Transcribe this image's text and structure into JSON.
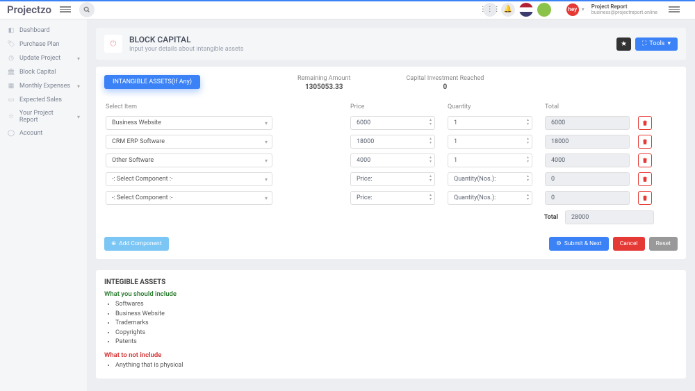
{
  "brand": "Projectzo",
  "user": {
    "title": "Project Report",
    "sub": "business@projectreport.online",
    "avatar_text": "hey"
  },
  "sidebar": {
    "items": [
      {
        "label": "Dashboard",
        "icon": "dashboard"
      },
      {
        "label": "Purchase Plan",
        "icon": "tag"
      },
      {
        "label": "Update Project",
        "icon": "clock",
        "chev": true
      },
      {
        "label": "Block Capital",
        "icon": "bank"
      },
      {
        "label": "Monthly Expenses",
        "icon": "cal",
        "chev": true
      },
      {
        "label": "Expected Sales",
        "icon": "sales"
      },
      {
        "label": "Your Project Report",
        "icon": "star",
        "chev": true
      },
      {
        "label": "Account",
        "icon": "user"
      }
    ]
  },
  "page": {
    "title": "BLOCK CAPITAL",
    "subtitle": "Input your details about intangible assets",
    "tools_label": "Tools"
  },
  "tab": {
    "label": "INTANGIBLE ASSETS(If Any)"
  },
  "metrics": {
    "remaining_label": "Remaining Amount",
    "remaining_value": "1305053.33",
    "reached_label": "Capital Investment Reached",
    "reached_value": "0"
  },
  "columns": {
    "item": "Select Item",
    "price": "Price",
    "qty": "Quantity",
    "total": "Total"
  },
  "rows": [
    {
      "item": "Business Website",
      "price": "6000",
      "qty": "1",
      "total": "6000"
    },
    {
      "item": "CRM ERP Software",
      "price": "18000",
      "qty": "1",
      "total": "18000"
    },
    {
      "item": "Other Software",
      "price": "4000",
      "qty": "1",
      "total": "4000"
    },
    {
      "item": "-: Select Component :-",
      "price": "Price:",
      "qty": "Quantity(Nos.):",
      "total": "0"
    },
    {
      "item": "-: Select Component :-",
      "price": "Price:",
      "qty": "Quantity(Nos.):",
      "total": "0"
    }
  ],
  "total": {
    "label": "Total",
    "value": "28000"
  },
  "buttons": {
    "add": "Add Component",
    "submit": "Submit & Next",
    "cancel": "Cancel",
    "reset": "Reset"
  },
  "info": {
    "heading": "INTEGIBLE ASSETS",
    "include_heading": "What you should include",
    "include": [
      "Softwares",
      "Business Website",
      "Trademarks",
      "Copyrights",
      "Patents"
    ],
    "exclude_heading": "What to not include",
    "exclude": [
      "Anything that is physical"
    ]
  }
}
